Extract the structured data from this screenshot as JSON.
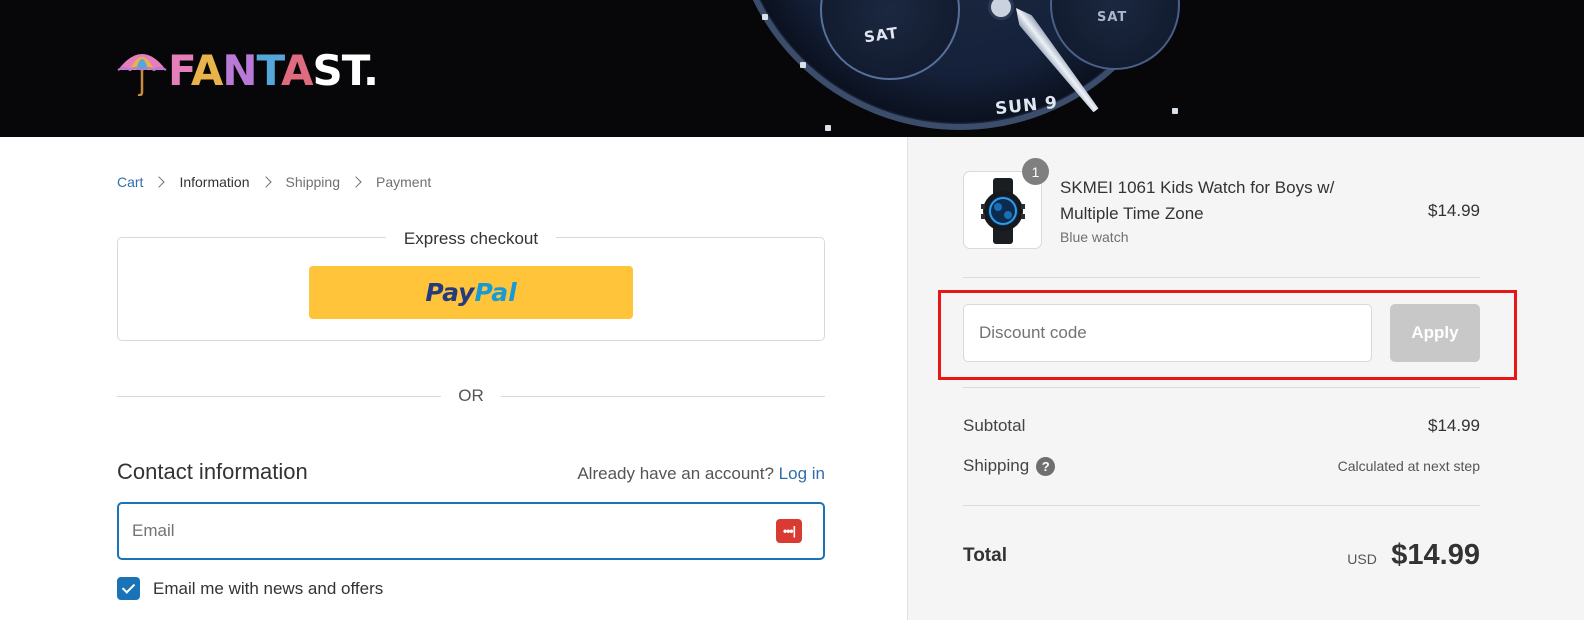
{
  "header": {
    "logo_text": "FANTAST.",
    "banner_watch_labels": {
      "sat_left": "SAT",
      "sat_right": "SAT",
      "day": "SUN",
      "date": "9"
    }
  },
  "breadcrumb": {
    "items": [
      "Cart",
      "Information",
      "Shipping",
      "Payment"
    ],
    "current": "Information"
  },
  "express": {
    "title": "Express checkout",
    "paypal_part1": "Pay",
    "paypal_part2": "Pal"
  },
  "divider_text": "OR",
  "contact": {
    "heading": "Contact information",
    "account_prompt": "Already have an account?",
    "login_link": "Log in",
    "email_placeholder": "Email",
    "password_manager_icon": "•••|",
    "newsletter_label": "Email me with news and offers",
    "newsletter_checked": true
  },
  "order": {
    "product": {
      "quantity": "1",
      "title": "SKMEI 1061 Kids Watch for Boys w/ Multiple Time Zone",
      "variant": "Blue watch",
      "price": "$14.99"
    },
    "discount": {
      "placeholder": "Discount code",
      "apply_label": "Apply"
    },
    "subtotal_label": "Subtotal",
    "subtotal_value": "$14.99",
    "shipping_label": "Shipping",
    "shipping_help_icon": "?",
    "shipping_value": "Calculated at next step",
    "total_label": "Total",
    "currency": "USD",
    "total_value": "$14.99"
  },
  "colors": {
    "link": "#2f6fab",
    "accent": "#1a73b7",
    "paypal_yellow": "#ffc439",
    "highlight_red": "#ea1616",
    "apply_disabled": "#c8c8c8"
  }
}
